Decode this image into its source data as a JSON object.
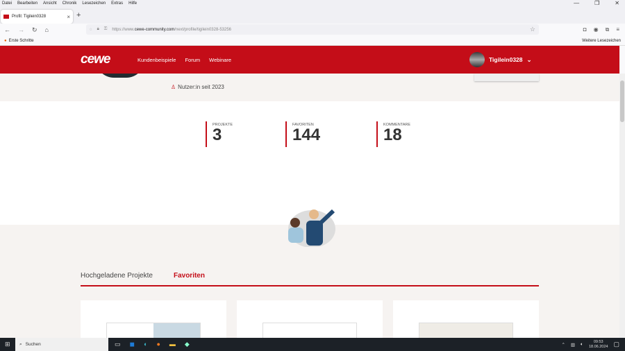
{
  "browser": {
    "menu": [
      "Datei",
      "Bearbeiten",
      "Ansicht",
      "Chronik",
      "Lesezeichen",
      "Extras",
      "Hilfe"
    ],
    "tab_title": "Profil: Tigilein0328",
    "url_prefix": "https://www.",
    "url_domain": "cewe-community.com",
    "url_path": "/next/profile/tigilein0328-53256",
    "bookmark": "Erste Schritte",
    "other_bookmarks": "Weitere Lesezeichen"
  },
  "site": {
    "logo": "cewe",
    "nav": [
      "Kundenbeispiele",
      "Forum",
      "Webinare"
    ],
    "username": "Tigilein0328",
    "member_since": "Nutzer:in seit 2023",
    "stats": [
      {
        "label": "PROJEKTE",
        "value": "3"
      },
      {
        "label": "FAVORITEN",
        "value": "144"
      },
      {
        "label": "KOMMENTARE",
        "value": "18"
      }
    ],
    "tabs": [
      "Hochgeladene Projekte",
      "Favoriten"
    ],
    "accent": "#c40d18"
  },
  "taskbar": {
    "search": "Suchen",
    "time": "09:53",
    "date": "18.06.2024"
  }
}
